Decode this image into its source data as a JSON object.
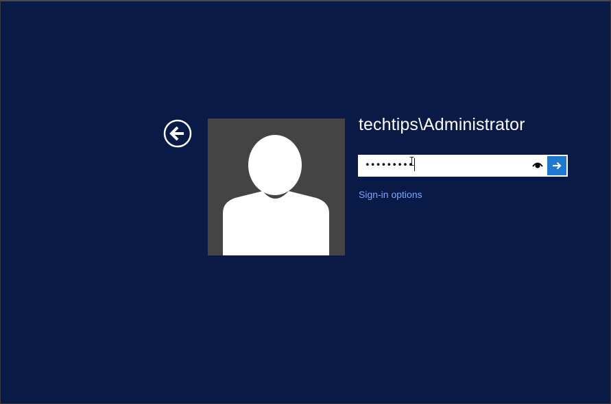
{
  "screen": {
    "background_color": "#091a47",
    "accent_color": "#1f78cf",
    "link_color": "#78a8ff"
  },
  "back_button": {
    "icon": "back-arrow-icon"
  },
  "user": {
    "avatar_icon": "user-silhouette-icon",
    "username": "techtips\\Administrator"
  },
  "password_field": {
    "value": "•••••••••",
    "reveal_icon": "eye-icon",
    "submit_icon": "arrow-right-icon"
  },
  "sign_in_options": {
    "label": "Sign-in options"
  }
}
